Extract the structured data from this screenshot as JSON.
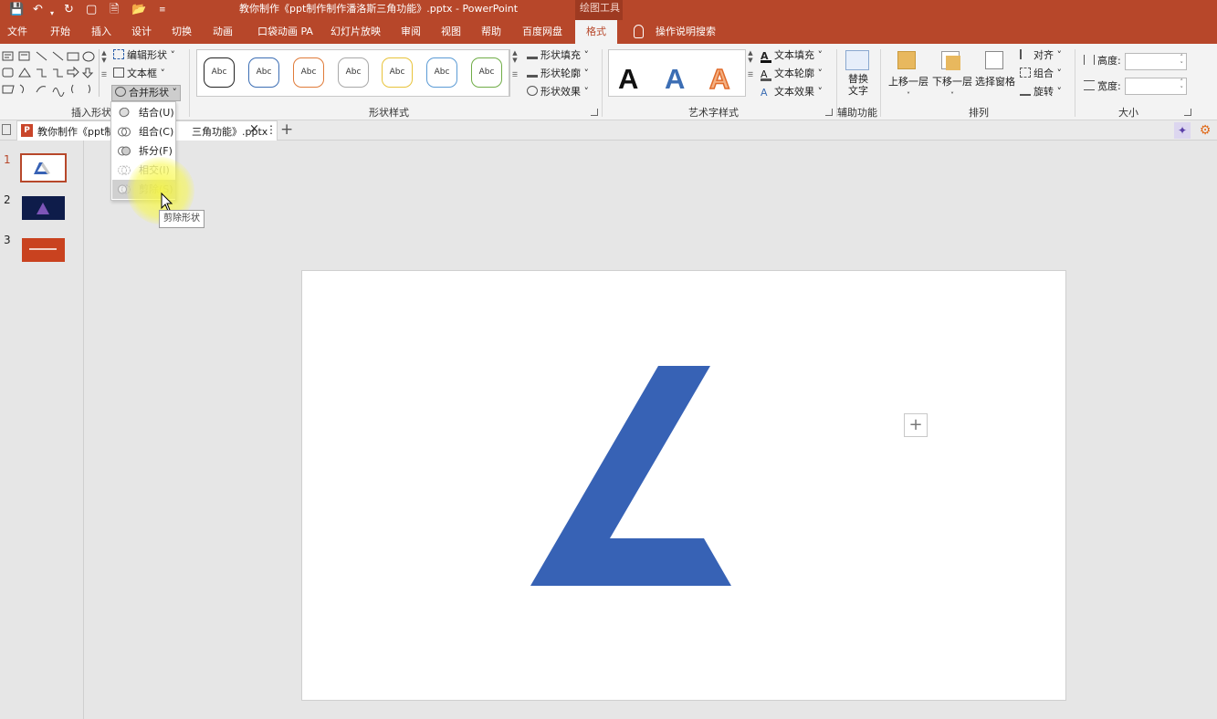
{
  "window": {
    "title": "教你制作《ppt制作制作潘洛斯三角功能》.pptx  -  PowerPoint",
    "context_tab_group": "绘图工具"
  },
  "tabs": [
    "文件",
    "开始",
    "插入",
    "设计",
    "切换",
    "动画",
    "口袋动画 PA",
    "幻灯片放映",
    "审阅",
    "视图",
    "帮助",
    "百度网盘",
    "格式"
  ],
  "active_tab": "格式",
  "help_search": "操作说明搜索",
  "ribbon": {
    "insert_shapes": {
      "label": "插入形状",
      "edit_shape": "编辑形状",
      "text_box": "文本框",
      "merge_shapes": "合并形状"
    },
    "shape_styles": {
      "label": "形状样式",
      "samples": [
        "Abc",
        "Abc",
        "Abc",
        "Abc",
        "Abc",
        "Abc",
        "Abc"
      ],
      "fill": "形状填充",
      "outline": "形状轮廓",
      "effects": "形状效果"
    },
    "wordart": {
      "label": "艺术字样式",
      "letter": "A",
      "text_fill": "文本填充",
      "text_outline": "文本轮廓",
      "text_effects": "文本效果"
    },
    "accessibility": {
      "label": "辅助功能",
      "alt_text_line1": "替换",
      "alt_text_line2": "文字"
    },
    "arrange": {
      "label": "排列",
      "bring_forward": "上移一层",
      "send_backward": "下移一层",
      "selection_pane": "选择窗格",
      "align": "对齐",
      "group": "组合",
      "rotate": "旋转"
    },
    "size": {
      "label": "大小",
      "height_label": "高度:",
      "width_label": "宽度:",
      "height_value": "",
      "width_value": ""
    }
  },
  "document_tab": {
    "title_left": "教你制作《ppt制",
    "title_right": "三角功能》.pptx"
  },
  "slides": [
    "1",
    "2",
    "3"
  ],
  "merge_menu": {
    "items": [
      {
        "label": "结合(U)",
        "enabled": true
      },
      {
        "label": "组合(C)",
        "enabled": true
      },
      {
        "label": "拆分(F)",
        "enabled": true
      },
      {
        "label": "相交(I)",
        "enabled": false
      },
      {
        "label": "剪除(S)",
        "enabled": false
      }
    ],
    "tooltip": "剪除形状"
  },
  "colors": {
    "ppt_accent": "#b7472a",
    "shape_fill": "#3762b5",
    "style_outlines": [
      "#222222",
      "#3c6eb4",
      "#e07b39",
      "#a8a8a8",
      "#e8c33a",
      "#5b9bd5",
      "#70ad47"
    ]
  }
}
